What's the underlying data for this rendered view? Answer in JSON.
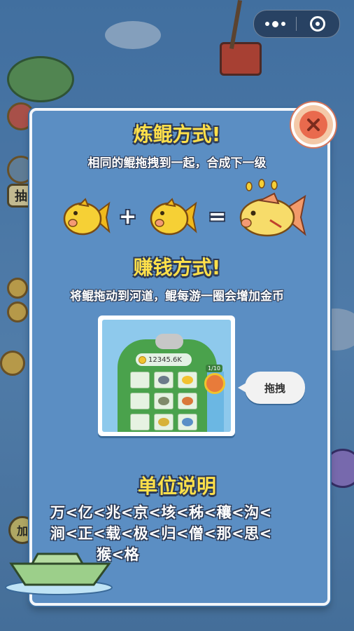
{
  "background": {
    "side_label_partial": "抽",
    "side_label_partial2": "加"
  },
  "capsule": {
    "more_icon": "more-dots-icon",
    "close_icon": "target-circle-icon"
  },
  "dialog": {
    "close_icon": "close-x-icon",
    "section1": {
      "title": "炼鲲方式!",
      "desc": "相同的鲲拖拽到一起，合成下一级",
      "plus": "+",
      "equals": "="
    },
    "section2": {
      "title": "赚钱方式!",
      "desc": "将鲲拖动到河道，鲲每游一圈会增加金币",
      "screenshot": {
        "coins": "12345.6K",
        "level": "1/10"
      },
      "bubble": "拖拽"
    },
    "section3": {
      "title": "单位说明",
      "line1": "万<亿<兆<京<垓<秭<穰<沟<",
      "line2": "涧<正<载<极<归<僧<那<思<",
      "line3": "猴<格"
    }
  },
  "colors": {
    "title": "#ffe04a",
    "dialog_bg": "#5b8ec3",
    "close_red": "#e96a4d"
  }
}
